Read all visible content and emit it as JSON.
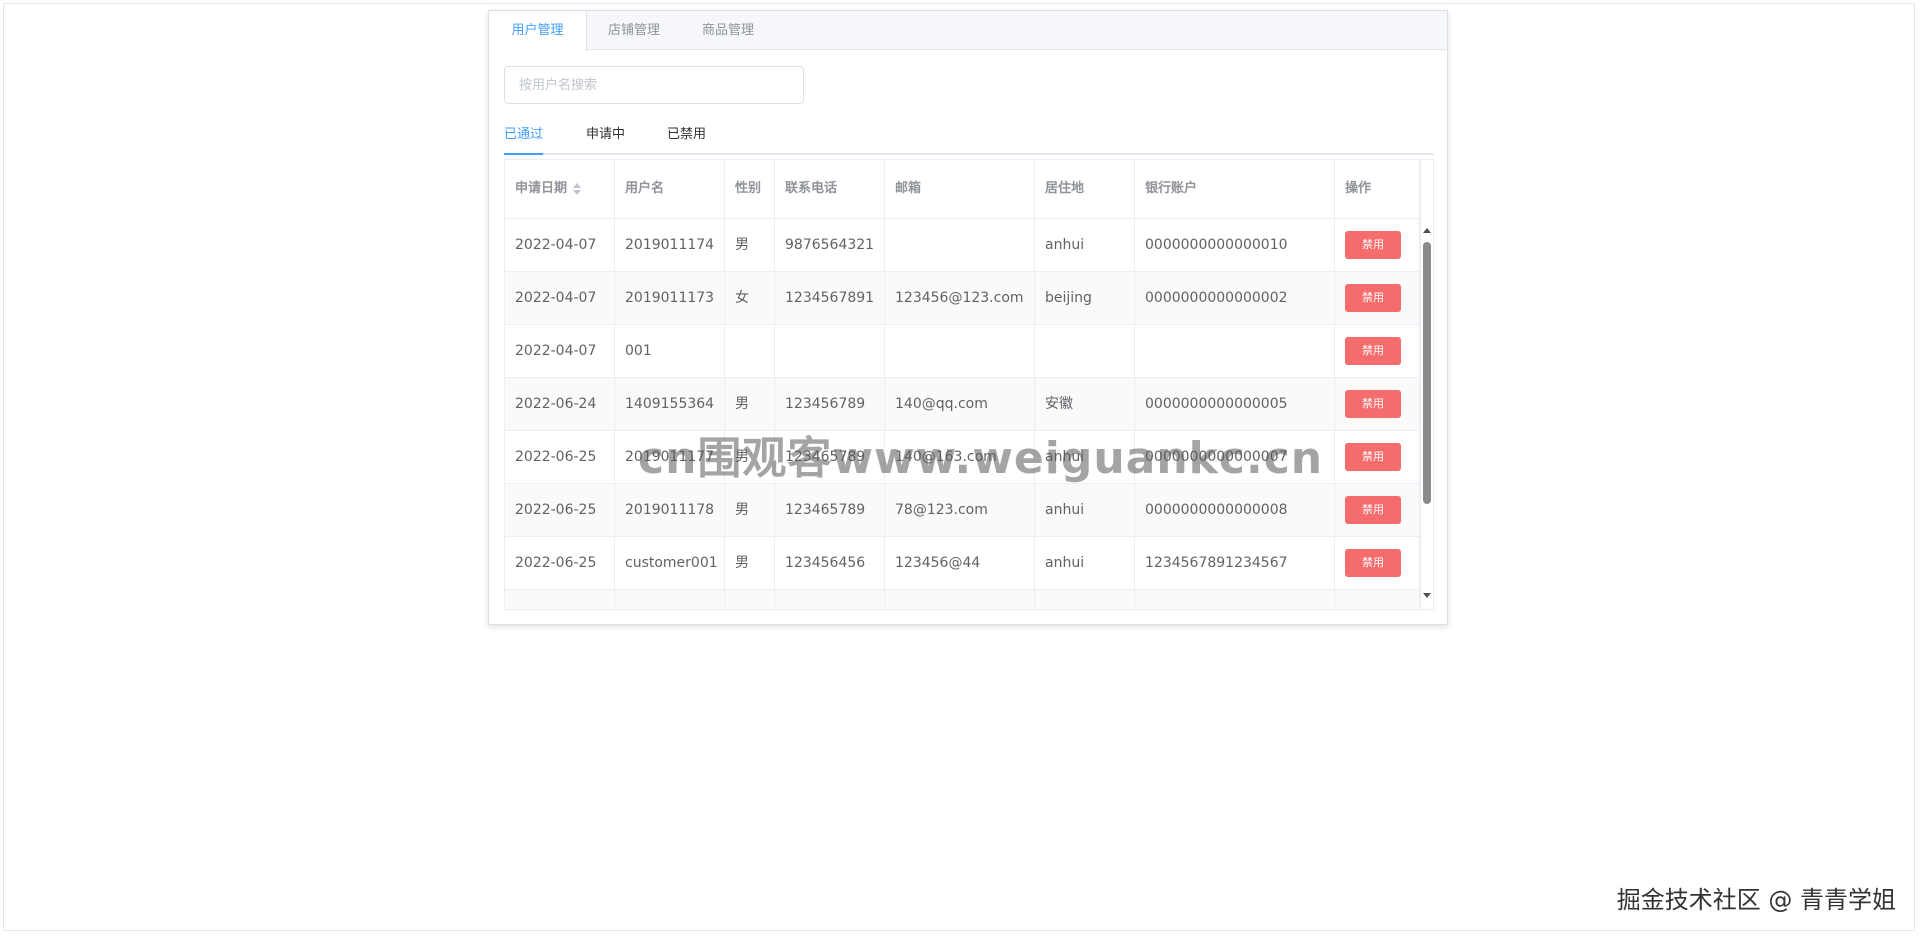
{
  "main_tabs": [
    {
      "label": "用户管理",
      "active": true
    },
    {
      "label": "店铺管理",
      "active": false
    },
    {
      "label": "商品管理",
      "active": false
    }
  ],
  "search": {
    "placeholder": "按用户名搜索",
    "value": ""
  },
  "sub_tabs": [
    {
      "label": "已通过",
      "active": true
    },
    {
      "label": "申请中",
      "active": false
    },
    {
      "label": "已禁用",
      "active": false
    }
  ],
  "table": {
    "headers": [
      "申请日期",
      "用户名",
      "性别",
      "联系电话",
      "邮箱",
      "居住地",
      "银行账户",
      "操作"
    ],
    "sortable_column": "申请日期",
    "action_label": "禁用",
    "rows": [
      [
        "2022-04-07",
        "2019011174",
        "男",
        "9876564321",
        "",
        "anhui",
        "0000000000000010"
      ],
      [
        "2022-04-07",
        "2019011173",
        "女",
        "1234567891",
        "123456@123.com",
        "beijing",
        "0000000000000002"
      ],
      [
        "2022-04-07",
        "001",
        "",
        "",
        "",
        "",
        ""
      ],
      [
        "2022-06-24",
        "1409155364",
        "男",
        "123456789",
        "140@qq.com",
        "安徽",
        "0000000000000005"
      ],
      [
        "2022-06-25",
        "2019011177",
        "男",
        "123465789",
        "140@163.com",
        "anhui",
        "0000000000000007"
      ],
      [
        "2022-06-25",
        "2019011178",
        "男",
        "123465789",
        "78@123.com",
        "anhui",
        "0000000000000008"
      ],
      [
        "2022-06-25",
        "customer001",
        "男",
        "123456456",
        "123456@44",
        "anhui",
        "1234567891234567"
      ]
    ]
  },
  "watermark": "cn围观客www.weiguankc.cn",
  "credit": "掘金技术社区 @ 青青学姐",
  "colors": {
    "accent": "#409eff",
    "danger_button": "#f56c6c",
    "header_bg": "#f5f7fa",
    "stripe": "#fafafa"
  }
}
